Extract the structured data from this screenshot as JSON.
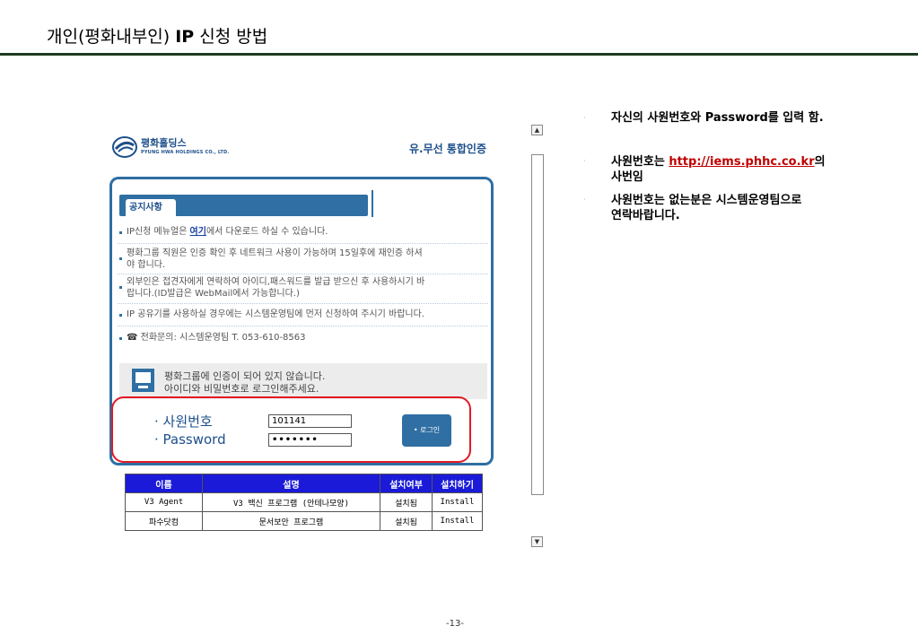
{
  "slide": {
    "title_prefix": "개인(평화내부인)",
    "title_bold": "IP",
    "title_suffix": "신청 방법",
    "page_number": "-13-"
  },
  "portal": {
    "logo_korean": "평화홀딩스",
    "logo_english": "PYUNG HWA HOLDINGS CO., LTD.",
    "auth_title": "유.무선 통합인증",
    "notice_tab": "공지사항",
    "notices": [
      {
        "pre": "IP신청 메뉴얼은 ",
        "link": "여기",
        "post": "에서 다운로드 하실 수 있습니다."
      },
      {
        "line1": "평화그룹 직원은 인증 확인 후 네트워크 사용이 가능하며 15일후에 재인증 하셔",
        "line2": "야 합니다."
      },
      {
        "line1": "외부인은 접견자에게 연락하여 아이디,패스워드를 발급 받으신 후 사용하시기 바",
        "line2": "랍니다.(ID발급은 WebMail에서 가능합니다.)"
      },
      {
        "text": "IP 공유기를 사용하실 경우에는 시스템운영팀에 먼저 신청하여 주시기 바랍니다."
      },
      {
        "phone_icon": "☎",
        "text": "전화문의: 시스템운영팀 T. 053-610-8563"
      }
    ],
    "status_line1": "평화그룹에 인증이 되어 있지 않습니다.",
    "status_line2": "아이디와 비밀번호로 로그인해주세요.",
    "employee_label": "· 사원번호",
    "password_label": "· Password",
    "employee_value": "101141",
    "password_value": "•••••••",
    "login_button": "• 로그인"
  },
  "software_table": {
    "headers": [
      "이름",
      "설명",
      "설치여부",
      "설치하기"
    ],
    "rows": [
      [
        "V3 Agent",
        "V3 백신 프로그램 (안테나모양)",
        "설치됨",
        "Install"
      ],
      [
        "파수닷컴",
        "문서보안 프로그램",
        "설치됨",
        "Install"
      ]
    ]
  },
  "scrollbar": {
    "up": "▲",
    "down": "▼"
  },
  "instructions": {
    "bullet": "·",
    "item1_pre": "자신의 사원번호와 ",
    "item1_bold": "Password를 입력 함.",
    "item2_pre": "사원번호는 ",
    "item2_link": "http://iems.phhc.co.kr",
    "item2_post": "의",
    "item2_line2": "사번임",
    "item3_line1": "사원번호는 없는분은 시스템운영팀으로",
    "item3_line2": "연락바랍니다."
  },
  "colors": {
    "accent_blue": "#2f6fa3",
    "table_header": "#1a1ad8",
    "highlight_red": "#e21a24",
    "link_red": "#c00000"
  }
}
